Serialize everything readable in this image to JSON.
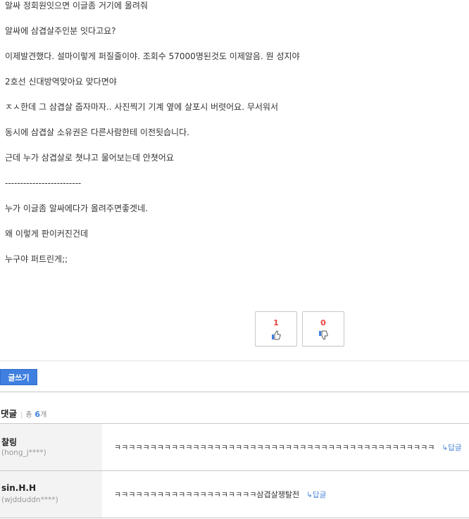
{
  "post": {
    "lines": [
      "알싸 정회원잇으면 이글좀 거기에 올려줘",
      "알싸에 삼겹살주인분 잇다고요?",
      "이제발견했다. 설마이렇게 퍼질줄이야. 조회수 57000명된것도 이제알음. 뭔 성지야",
      "2호선 신대방역맞아요 맞다면야",
      "ㅈㅅ한데 그 삼겹살 줍자마자.. 사진찍기 기계 옆에 살포시 버렷어요. 무서워서",
      "동시에 삼겹살 소유권은 다른사람한테 이전됫습니다.",
      "근데 누가 삼겹살로 쳣냐고 물어보는데 안쳣어요",
      "-------------------------",
      "누가 이글좀 알싸에다가 올려주면좋겟네.",
      "왜 이렇게 판이커진건데",
      "누구야 퍼트린게;;"
    ]
  },
  "votes": {
    "up": {
      "count": "1",
      "icon": "thumbs-up-icon",
      "color": "#3f7fe0"
    },
    "down": {
      "count": "0",
      "icon": "thumbs-down-icon",
      "color": "#3f7fe0"
    },
    "count_color": "#e8433a"
  },
  "write_button": {
    "label": "글쓰기",
    "color": "#3f7fe0"
  },
  "comments": {
    "title": "댓글",
    "total_label": "총",
    "count": "6",
    "unit": "개",
    "items": [
      {
        "nickname": "찰링",
        "user_id": "(hong_j****)",
        "text": "ㅋㅋㅋㅋㅋㅋㅋㅋㅋㅋㅋㅋㅋㅋㅋㅋㅋㅋㅋㅋㅋㅋㅋㅋㅋㅋㅋㅋㅋㅋㅋㅋㅋㅋㅋㅋㅋㅋㅋㅋㅋㅋㅋㅋㅋ",
        "reply": "↳답글"
      },
      {
        "nickname": "sin.H.H",
        "user_id": "(wjdduddn****)",
        "text": "ㅋㅋㅋㅋㅋㅋㅋㅋㅋㅋㅋㅋㅋㅋㅋㅋㅋㅋㅋㅋ삼겹살쟁탈전",
        "reply": "↳답글"
      }
    ]
  }
}
